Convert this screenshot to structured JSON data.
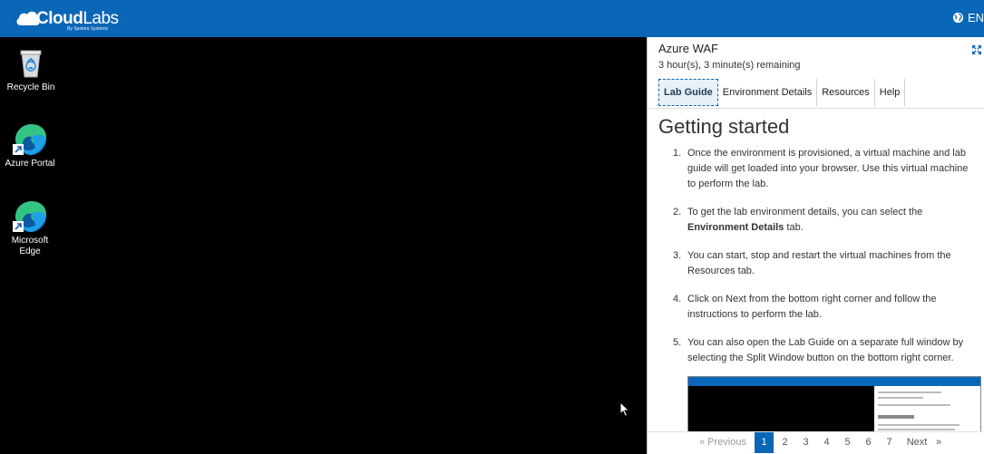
{
  "header": {
    "brand_bold": "Cloud",
    "brand_thin": "Labs",
    "brand_sub": "By Spektra Systems",
    "language": "EN",
    "brand_color": "#0a66b7"
  },
  "desktop": {
    "icons": [
      {
        "label": "Recycle Bin",
        "icon": "recycle-bin-icon"
      },
      {
        "label": "Azure Portal",
        "icon": "edge-icon"
      },
      {
        "label": "Microsoft Edge",
        "icon": "edge-icon"
      }
    ]
  },
  "panel": {
    "title": "Azure WAF",
    "time_remaining": "3 hour(s), 3 minute(s) remaining",
    "tabs": [
      "Lab Guide",
      "Environment Details",
      "Resources",
      "Help"
    ],
    "active_tab": "Lab Guide",
    "heading": "Getting started",
    "steps": [
      {
        "num": "1.",
        "text": "Once the environment is provisioned, a virtual machine and lab guide will get loaded into your browser. Use this virtual machine to perform the lab."
      },
      {
        "num": "2.",
        "text_before": "To get the lab environment details, you can select the ",
        "bold": "Environment Details",
        "text_after": " tab."
      },
      {
        "num": "3.",
        "text": "You can start, stop and restart the virtual machines from the Resources tab."
      },
      {
        "num": "4.",
        "text": "Click on Next from the bottom right corner and follow the instructions to perform the lab."
      },
      {
        "num": "5.",
        "text": "You can also open the Lab Guide on a separate full window by selecting the Split Window button on the bottom right corner."
      }
    ],
    "pager": {
      "previous": "« Previous",
      "pages": [
        "1",
        "2",
        "3",
        "4",
        "5",
        "6",
        "7"
      ],
      "current": "1",
      "next": "Next",
      "next_arrow": "»"
    }
  }
}
